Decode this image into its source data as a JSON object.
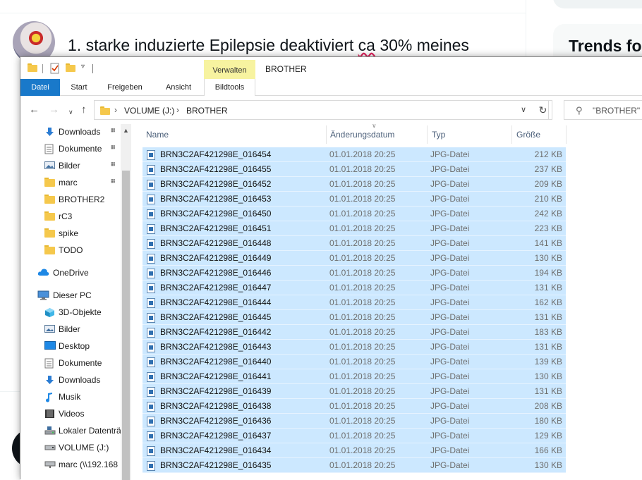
{
  "background": {
    "tweet_text_before": "1. starke induzierte Epilepsie deaktiviert ",
    "tweet_text_spell": "ca",
    "tweet_text_after": " 30% meines",
    "trends_title": "Trends fo"
  },
  "window": {
    "title": "BROTHER",
    "contextual_tab_label": "Verwalten"
  },
  "ribbon": {
    "tabs": [
      "Datei",
      "Start",
      "Freigeben",
      "Ansicht",
      "Bildtools"
    ]
  },
  "address": {
    "segments": [
      "VOLUME (J:)",
      "BROTHER"
    ],
    "search_placeholder": "\"BROTHER\" d"
  },
  "navigation": {
    "items": [
      {
        "label": "Downloads",
        "icon": "download-arrow-icon",
        "pinned": true
      },
      {
        "label": "Dokumente",
        "icon": "document-icon",
        "pinned": true
      },
      {
        "label": "Bilder",
        "icon": "pictures-icon",
        "pinned": true
      },
      {
        "label": "marc",
        "icon": "folder-icon",
        "pinned": true
      },
      {
        "label": "BROTHER2",
        "icon": "folder-icon",
        "pinned": false
      },
      {
        "label": "rC3",
        "icon": "folder-icon",
        "pinned": false
      },
      {
        "label": "spike",
        "icon": "folder-icon",
        "pinned": false
      },
      {
        "label": "TODO",
        "icon": "folder-icon",
        "pinned": false
      },
      {
        "label": "OneDrive",
        "icon": "onedrive-cloud-icon",
        "pinned": false
      },
      {
        "label": "Dieser PC",
        "icon": "computer-icon",
        "pinned": false
      },
      {
        "label": "3D-Objekte",
        "icon": "3d-objects-icon",
        "pinned": false
      },
      {
        "label": "Bilder",
        "icon": "pictures-icon",
        "pinned": false
      },
      {
        "label": "Desktop",
        "icon": "desktop-icon",
        "pinned": false
      },
      {
        "label": "Dokumente",
        "icon": "document-icon",
        "pinned": false
      },
      {
        "label": "Downloads",
        "icon": "download-arrow-icon",
        "pinned": false
      },
      {
        "label": "Musik",
        "icon": "music-note-icon",
        "pinned": false
      },
      {
        "label": "Videos",
        "icon": "video-film-icon",
        "pinned": false
      },
      {
        "label": "Lokaler Datenträ",
        "icon": "local-disk-icon",
        "pinned": false
      },
      {
        "label": "VOLUME (J:)",
        "icon": "drive-icon",
        "pinned": false
      },
      {
        "label": "marc (\\\\192.168",
        "icon": "network-drive-icon",
        "pinned": false
      }
    ]
  },
  "columns": {
    "name": "Name",
    "date": "Änderungsdatum",
    "type": "Typ",
    "size": "Größe"
  },
  "files": [
    {
      "name": "BRN3C2AF421298E_016454",
      "date": "01.01.2018 20:25",
      "type": "JPG-Datei",
      "size": "212 KB"
    },
    {
      "name": "BRN3C2AF421298E_016455",
      "date": "01.01.2018 20:25",
      "type": "JPG-Datei",
      "size": "237 KB"
    },
    {
      "name": "BRN3C2AF421298E_016452",
      "date": "01.01.2018 20:25",
      "type": "JPG-Datei",
      "size": "209 KB"
    },
    {
      "name": "BRN3C2AF421298E_016453",
      "date": "01.01.2018 20:25",
      "type": "JPG-Datei",
      "size": "210 KB"
    },
    {
      "name": "BRN3C2AF421298E_016450",
      "date": "01.01.2018 20:25",
      "type": "JPG-Datei",
      "size": "242 KB"
    },
    {
      "name": "BRN3C2AF421298E_016451",
      "date": "01.01.2018 20:25",
      "type": "JPG-Datei",
      "size": "223 KB"
    },
    {
      "name": "BRN3C2AF421298E_016448",
      "date": "01.01.2018 20:25",
      "type": "JPG-Datei",
      "size": "141 KB"
    },
    {
      "name": "BRN3C2AF421298E_016449",
      "date": "01.01.2018 20:25",
      "type": "JPG-Datei",
      "size": "130 KB"
    },
    {
      "name": "BRN3C2AF421298E_016446",
      "date": "01.01.2018 20:25",
      "type": "JPG-Datei",
      "size": "194 KB"
    },
    {
      "name": "BRN3C2AF421298E_016447",
      "date": "01.01.2018 20:25",
      "type": "JPG-Datei",
      "size": "131 KB"
    },
    {
      "name": "BRN3C2AF421298E_016444",
      "date": "01.01.2018 20:25",
      "type": "JPG-Datei",
      "size": "162 KB"
    },
    {
      "name": "BRN3C2AF421298E_016445",
      "date": "01.01.2018 20:25",
      "type": "JPG-Datei",
      "size": "131 KB"
    },
    {
      "name": "BRN3C2AF421298E_016442",
      "date": "01.01.2018 20:25",
      "type": "JPG-Datei",
      "size": "183 KB"
    },
    {
      "name": "BRN3C2AF421298E_016443",
      "date": "01.01.2018 20:25",
      "type": "JPG-Datei",
      "size": "131 KB"
    },
    {
      "name": "BRN3C2AF421298E_016440",
      "date": "01.01.2018 20:25",
      "type": "JPG-Datei",
      "size": "139 KB"
    },
    {
      "name": "BRN3C2AF421298E_016441",
      "date": "01.01.2018 20:25",
      "type": "JPG-Datei",
      "size": "130 KB"
    },
    {
      "name": "BRN3C2AF421298E_016439",
      "date": "01.01.2018 20:25",
      "type": "JPG-Datei",
      "size": "131 KB"
    },
    {
      "name": "BRN3C2AF421298E_016438",
      "date": "01.01.2018 20:25",
      "type": "JPG-Datei",
      "size": "208 KB"
    },
    {
      "name": "BRN3C2AF421298E_016436",
      "date": "01.01.2018 20:25",
      "type": "JPG-Datei",
      "size": "180 KB"
    },
    {
      "name": "BRN3C2AF421298E_016437",
      "date": "01.01.2018 20:25",
      "type": "JPG-Datei",
      "size": "129 KB"
    },
    {
      "name": "BRN3C2AF421298E_016434",
      "date": "01.01.2018 20:25",
      "type": "JPG-Datei",
      "size": "166 KB"
    },
    {
      "name": "BRN3C2AF421298E_016435",
      "date": "01.01.2018 20:25",
      "type": "JPG-Datei",
      "size": "130 KB"
    }
  ],
  "colors": {
    "selection": "#cce8ff",
    "accent": "#1979ca",
    "contextual_tab": "#f7f3a0"
  }
}
